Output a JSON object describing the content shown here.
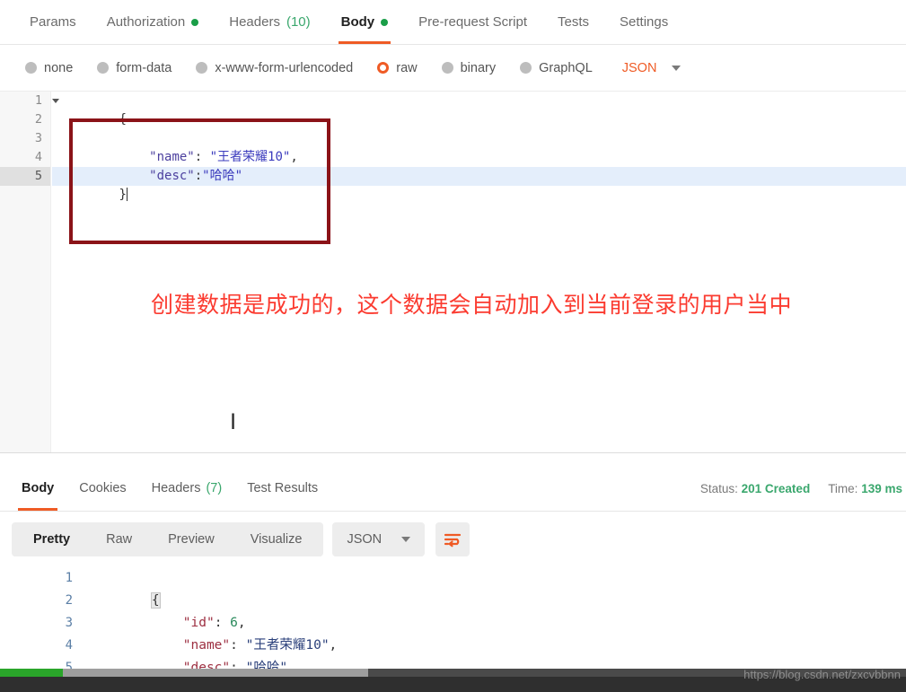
{
  "request": {
    "tabs": [
      {
        "label": "Params",
        "dot": false,
        "count": "",
        "active": false
      },
      {
        "label": "Authorization",
        "dot": true,
        "count": "",
        "active": false
      },
      {
        "label": "Headers",
        "dot": false,
        "count": "(10)",
        "active": false
      },
      {
        "label": "Body",
        "dot": true,
        "count": "",
        "active": true
      },
      {
        "label": "Pre-request Script",
        "dot": false,
        "count": "",
        "active": false
      },
      {
        "label": "Tests",
        "dot": false,
        "count": "",
        "active": false
      },
      {
        "label": "Settings",
        "dot": false,
        "count": "",
        "active": false
      }
    ],
    "body_types": [
      {
        "label": "none",
        "selected": false
      },
      {
        "label": "form-data",
        "selected": false
      },
      {
        "label": "x-www-form-urlencoded",
        "selected": false
      },
      {
        "label": "raw",
        "selected": true
      },
      {
        "label": "binary",
        "selected": false
      },
      {
        "label": "GraphQL",
        "selected": false
      }
    ],
    "format_label": "JSON",
    "editor": {
      "line_numbers": [
        "1",
        "2",
        "3",
        "4",
        "5"
      ],
      "lines": [
        {
          "text": "{",
          "active": false
        },
        {
          "text": "",
          "active": false
        },
        {
          "text": "    \"name\": \"王者荣耀10\",",
          "active": false
        },
        {
          "text": "    \"desc\":\"哈哈\"",
          "active": false
        },
        {
          "text": "}",
          "active": true
        }
      ],
      "line1_raw": "{",
      "line3_key": "\"name\"",
      "line3_sep": ": ",
      "line3_val": "\"王者荣耀10\"",
      "line3_comma": ",",
      "line4_key": "\"desc\"",
      "line4_sep": ":",
      "line4_val": "\"哈哈\"",
      "line5_raw": "}"
    }
  },
  "annotation": {
    "text": "创建数据是成功的，这个数据会自动加入到当前登录的用户当中",
    "box_color": "#8b1318",
    "text_color": "#fb3b30"
  },
  "cursor": {
    "glyph": "I"
  },
  "response": {
    "tabs": [
      {
        "label": "Body",
        "count": "",
        "active": true
      },
      {
        "label": "Cookies",
        "count": "",
        "active": false
      },
      {
        "label": "Headers",
        "count": "(7)",
        "active": false
      },
      {
        "label": "Test Results",
        "count": "",
        "active": false
      }
    ],
    "status_label": "Status:",
    "status_value": "201 Created",
    "time_label": "Time:",
    "time_value": "139 ms",
    "view_tabs": [
      {
        "label": "Pretty",
        "active": true
      },
      {
        "label": "Raw",
        "active": false
      },
      {
        "label": "Preview",
        "active": false
      },
      {
        "label": "Visualize",
        "active": false
      }
    ],
    "format_label": "JSON",
    "editor": {
      "line_numbers": [
        "1",
        "2",
        "3",
        "4",
        "5"
      ],
      "line1_raw": "{",
      "line2_key": "\"id\"",
      "line2_sep": ": ",
      "line2_val": "6",
      "line2_comma": ",",
      "line3_key": "\"name\"",
      "line3_sep": ": ",
      "line3_val": "\"王者荣耀10\"",
      "line3_comma": ",",
      "line4_key": "\"desc\"",
      "line4_sep": ": ",
      "line4_val": "\"哈哈\"",
      "line5_raw": "}"
    }
  },
  "watermark": {
    "text": "https://blog.csdn.net/zxcvbbnn"
  }
}
